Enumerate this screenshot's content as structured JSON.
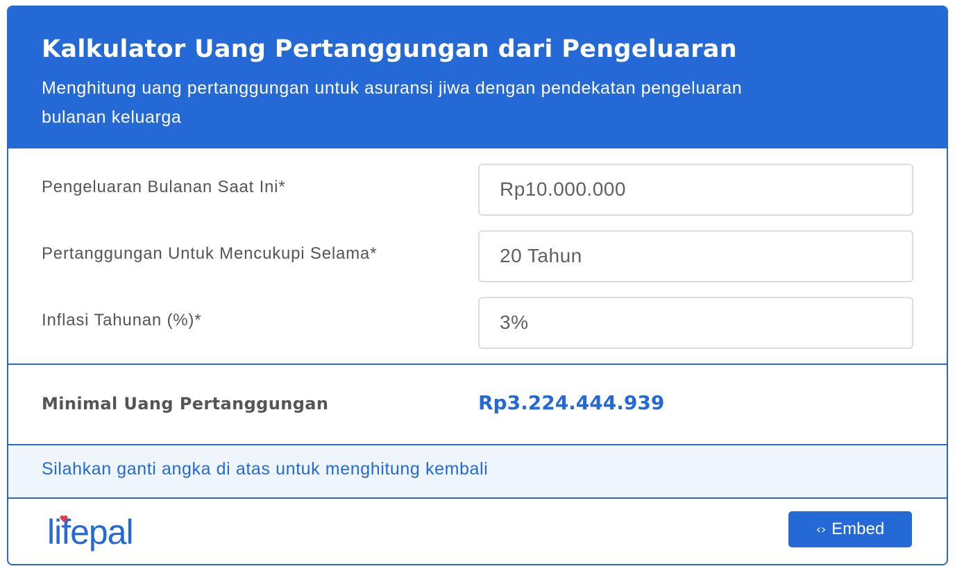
{
  "header": {
    "title": "Kalkulator Uang Pertanggungan dari Pengeluaran",
    "subtitle_line1": "Menghitung uang pertanggungan untuk asuransi jiwa dengan pendekatan pengeluaran",
    "subtitle_line2": "bulanan keluarga"
  },
  "form": {
    "fields": [
      {
        "label": "Pengeluaran Bulanan Saat Ini*",
        "value": "Rp10.000.000"
      },
      {
        "label": "Pertanggungan Untuk Mencukupi Selama*",
        "value": "20 Tahun"
      },
      {
        "label": "Inflasi Tahunan (%)*",
        "value": "3%"
      }
    ]
  },
  "result": {
    "label": "Minimal Uang Pertanggungan",
    "value": "Rp3.224.444.939"
  },
  "note": {
    "text": "Silahkan ganti angka di atas untuk menghitung kembali"
  },
  "footer": {
    "logo_text": "lifepal",
    "embed_label": "Embed",
    "embed_icon": "code-icon"
  },
  "colors": {
    "primary": "#2469d6",
    "note_bg": "#eff5fd",
    "heart": "#e8394a"
  }
}
